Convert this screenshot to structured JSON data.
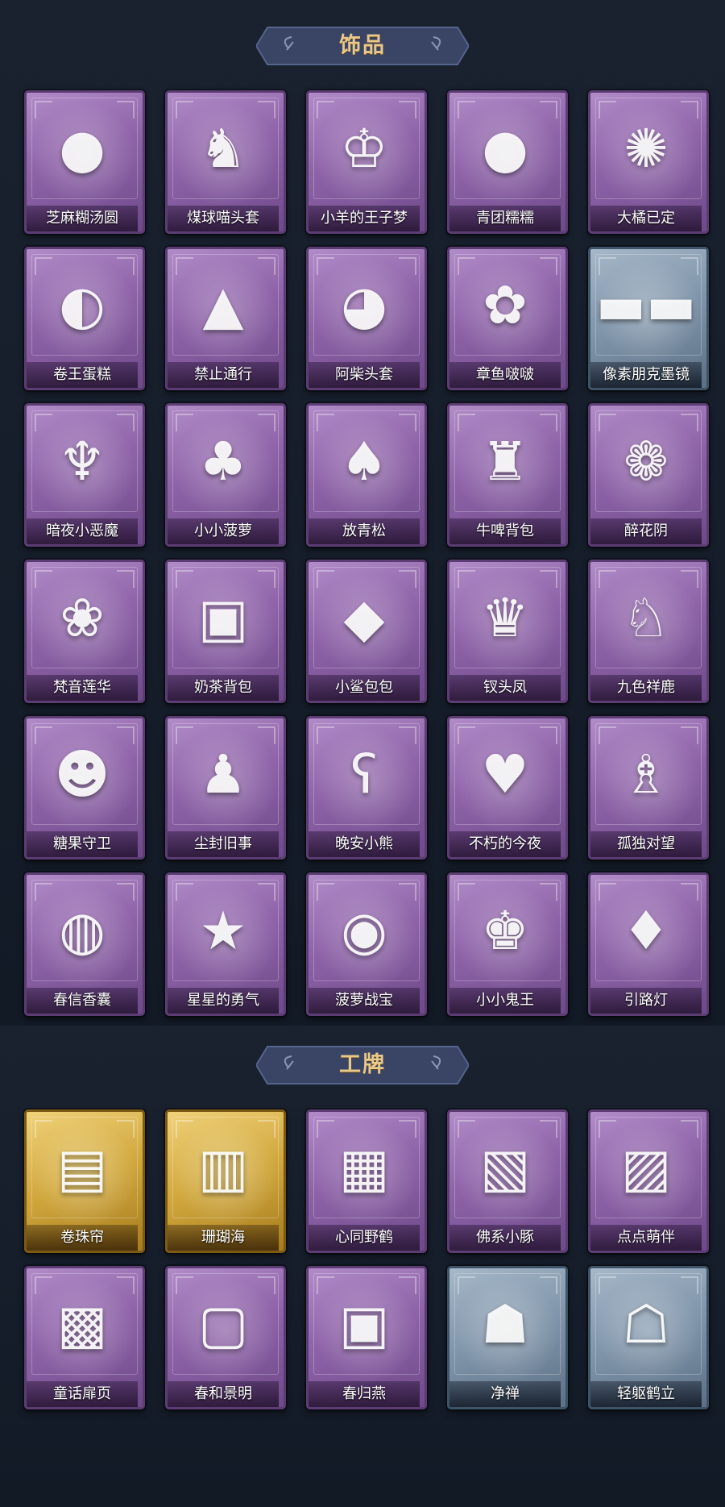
{
  "sections": [
    {
      "title": "饰品",
      "items": [
        {
          "label": "芝麻糊汤圆",
          "icon": "tangyuan-icon",
          "glyph": "●",
          "rarity": "purple"
        },
        {
          "label": "煤球喵头套",
          "icon": "cat-head-icon",
          "glyph": "♞",
          "rarity": "purple"
        },
        {
          "label": "小羊的王子梦",
          "icon": "sheep-crown-icon",
          "glyph": "♔",
          "rarity": "purple"
        },
        {
          "label": "青团糯糯",
          "icon": "green-dumpling-icon",
          "glyph": "●",
          "rarity": "purple"
        },
        {
          "label": "大橘已定",
          "icon": "orange-slice-icon",
          "glyph": "✺",
          "rarity": "purple"
        },
        {
          "label": "卷王蛋糕",
          "icon": "roll-cake-icon",
          "glyph": "◐",
          "rarity": "purple"
        },
        {
          "label": "禁止通行",
          "icon": "traffic-cone-icon",
          "glyph": "▲",
          "rarity": "purple"
        },
        {
          "label": "阿柴头套",
          "icon": "shiba-head-icon",
          "glyph": "◕",
          "rarity": "purple"
        },
        {
          "label": "章鱼啵啵",
          "icon": "octopus-icon",
          "glyph": "✿",
          "rarity": "purple"
        },
        {
          "label": "像素朋克墨镜",
          "icon": "pixel-sunglasses-icon",
          "glyph": "▬▬",
          "rarity": "blue"
        },
        {
          "label": "暗夜小恶魔",
          "icon": "little-devil-icon",
          "glyph": "♆",
          "rarity": "purple"
        },
        {
          "label": "小小菠萝",
          "icon": "pineapple-icon",
          "glyph": "♣",
          "rarity": "purple"
        },
        {
          "label": "放青松",
          "icon": "bonsai-pine-icon",
          "glyph": "♠",
          "rarity": "purple"
        },
        {
          "label": "牛啤背包",
          "icon": "beer-barrel-icon",
          "glyph": "♜",
          "rarity": "purple"
        },
        {
          "label": "醉花阴",
          "icon": "flower-ornament-icon",
          "glyph": "❁",
          "rarity": "purple"
        },
        {
          "label": "梵音莲华",
          "icon": "lotus-charm-icon",
          "glyph": "❀",
          "rarity": "purple"
        },
        {
          "label": "奶茶背包",
          "icon": "milk-tea-bag-icon",
          "glyph": "▣",
          "rarity": "purple"
        },
        {
          "label": "小鲨包包",
          "icon": "shark-bag-icon",
          "glyph": "◆",
          "rarity": "purple"
        },
        {
          "label": "钗头凤",
          "icon": "phoenix-crown-icon",
          "glyph": "♛",
          "rarity": "purple"
        },
        {
          "label": "九色祥鹿",
          "icon": "deer-charm-icon",
          "glyph": "♘",
          "rarity": "purple"
        },
        {
          "label": "糖果守卫",
          "icon": "pumpkin-guard-icon",
          "glyph": "☻",
          "rarity": "purple"
        },
        {
          "label": "尘封旧事",
          "icon": "boy-charm-icon",
          "glyph": "♟",
          "rarity": "purple"
        },
        {
          "label": "晚安小熊",
          "icon": "bear-charm-icon",
          "glyph": "ʕ",
          "rarity": "purple"
        },
        {
          "label": "不朽的今夜",
          "icon": "pig-charm-icon",
          "glyph": "♥",
          "rarity": "purple"
        },
        {
          "label": "孤独对望",
          "icon": "figure-charm-icon",
          "glyph": "♗",
          "rarity": "purple"
        },
        {
          "label": "春信香囊",
          "icon": "sachet-icon",
          "glyph": "◍",
          "rarity": "purple"
        },
        {
          "label": "星星的勇气",
          "icon": "planet-charm-icon",
          "glyph": "★",
          "rarity": "purple"
        },
        {
          "label": "菠萝战宝",
          "icon": "pineapple-robot-icon",
          "glyph": "◉",
          "rarity": "purple"
        },
        {
          "label": "小小鬼王",
          "icon": "ghost-king-icon",
          "glyph": "♚",
          "rarity": "purple"
        },
        {
          "label": "引路灯",
          "icon": "lantern-icon",
          "glyph": "♦",
          "rarity": "purple"
        }
      ]
    },
    {
      "title": "工牌",
      "items": [
        {
          "label": "卷珠帘",
          "icon": "curtain-badge-icon",
          "glyph": "▤",
          "rarity": "gold"
        },
        {
          "label": "珊瑚海",
          "icon": "coral-sea-badge-icon",
          "glyph": "▥",
          "rarity": "gold"
        },
        {
          "label": "心同野鹤",
          "icon": "crane-badge-icon",
          "glyph": "▦",
          "rarity": "purple"
        },
        {
          "label": "佛系小豚",
          "icon": "piglet-badge-icon",
          "glyph": "▧",
          "rarity": "purple"
        },
        {
          "label": "点点萌伴",
          "icon": "meadow-badge-icon",
          "glyph": "▨",
          "rarity": "purple"
        },
        {
          "label": "童话扉页",
          "icon": "fairytale-badge-icon",
          "glyph": "▩",
          "rarity": "purple"
        },
        {
          "label": "春和景明",
          "icon": "spring-badge-icon",
          "glyph": "▢",
          "rarity": "purple"
        },
        {
          "label": "春归燕",
          "icon": "swallow-badge-icon",
          "glyph": "▣",
          "rarity": "purple"
        },
        {
          "label": "净禅",
          "icon": "zen-silhouette-badge-icon",
          "glyph": "☗",
          "rarity": "blue"
        },
        {
          "label": "轻躯鹤立",
          "icon": "crane-silhouette-badge-icon",
          "glyph": "☖",
          "rarity": "blue"
        }
      ]
    }
  ]
}
